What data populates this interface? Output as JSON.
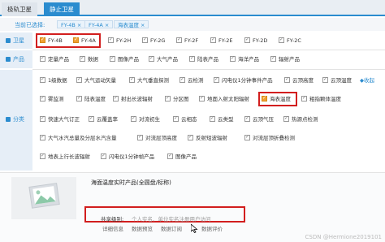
{
  "tabs": [
    "极轨卫星",
    "静止卫星"
  ],
  "selected": {
    "label": "当前已选择:",
    "chips": [
      "FY-4B",
      "FY-4A",
      "海表温度"
    ]
  },
  "rows": {
    "satellite": {
      "label": "卫星",
      "items": [
        {
          "text": "FY-4B",
          "checked": true
        },
        {
          "text": "FY-4A",
          "checked": true
        },
        {
          "text": "FY-2H",
          "checked": false
        },
        {
          "text": "FY-2G",
          "checked": false
        },
        {
          "text": "FY-2F",
          "checked": false
        },
        {
          "text": "FY-2E",
          "checked": false
        },
        {
          "text": "FY-2D",
          "checked": false
        },
        {
          "text": "FY-2C",
          "checked": false
        }
      ]
    },
    "product": {
      "label": "产品",
      "items": [
        {
          "text": "定量产品",
          "checked": false
        },
        {
          "text": "数据",
          "checked": false
        },
        {
          "text": "图像产品",
          "checked": false
        },
        {
          "text": "大气产品",
          "checked": false
        },
        {
          "text": "陆表产品",
          "checked": false
        },
        {
          "text": "海洋产品",
          "checked": false
        },
        {
          "text": "辐射产品",
          "checked": false
        }
      ]
    },
    "category": {
      "label": "分类",
      "collapse_label": "收起",
      "lines": [
        [
          {
            "text": "1级数据",
            "checked": false
          },
          {
            "text": "大气运动矢量",
            "checked": false
          },
          {
            "text": "大气垂直探测",
            "checked": false
          },
          {
            "text": "云检测",
            "checked": false
          },
          {
            "text": "闪电仪1分钟事件产品",
            "checked": false
          },
          {
            "text": "云顶高度",
            "checked": false
          },
          {
            "text": "云顶温度",
            "checked": false
          }
        ],
        [
          {
            "text": "雾监测",
            "checked": false
          },
          {
            "text": "陆表温度",
            "checked": false
          },
          {
            "text": "射出长波辐射",
            "checked": false
          },
          {
            "text": "分区图",
            "checked": false
          },
          {
            "text": "地面入射太阳辐射",
            "checked": false
          },
          {
            "text": "海表温度",
            "checked": true
          },
          {
            "text": "粗指颗体温度",
            "checked": false
          }
        ],
        [
          {
            "text": "快速大气订正",
            "checked": false
          },
          {
            "text": "云覆盖率",
            "checked": false
          },
          {
            "text": "对流初生",
            "checked": false
          },
          {
            "text": "云相态",
            "checked": false
          },
          {
            "text": "云类型",
            "checked": false
          },
          {
            "text": "云顶气压",
            "checked": false
          },
          {
            "text": "热源点检测",
            "checked": false
          }
        ],
        [
          {
            "text": "大气水汽总量及分层水汽含量",
            "checked": false
          },
          {
            "text": "对流层顶高度",
            "checked": false
          },
          {
            "text": "反射短波辐射",
            "checked": false
          },
          {
            "text": "对流层顶折叠检测",
            "checked": false
          }
        ],
        [
          {
            "text": "地表上行长波辐射",
            "checked": false
          },
          {
            "text": "闪电仪1分钟帧产品",
            "checked": false
          },
          {
            "text": "图像产品",
            "checked": false
          }
        ]
      ]
    }
  },
  "product_detail": {
    "title": "海面温度实时产品(全圆盘/标称)",
    "share_label": "共享级别:",
    "share_value": "个人实名、单位实名注册用户访问",
    "links": [
      "详细信息",
      "数据预览",
      "数据订阅",
      "数据评价"
    ]
  },
  "watermark": "CSDN @Hermione2019101"
}
